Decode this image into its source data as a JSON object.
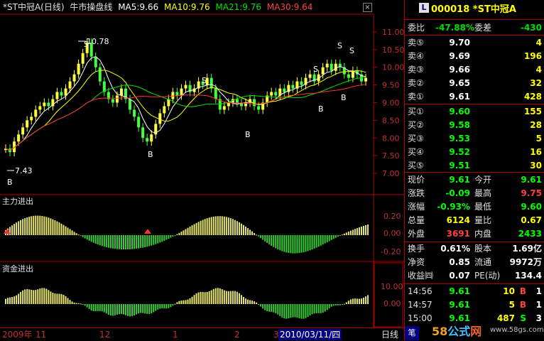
{
  "header": {
    "stock": "*ST中冠A(日线)",
    "indicator": "牛市操盘线",
    "ma5": "MA5:9.66",
    "ma10": "MA10:9.76",
    "ma21": "MA21:9.76",
    "ma30": "MA30:9.64"
  },
  "main_chart": {
    "y_ticks": [
      "11.00",
      "10.50",
      "10.00",
      "9.50",
      "9.00",
      "8.50",
      "8.00",
      "7.50",
      "7.00"
    ],
    "annotations": {
      "high_label": "10.78",
      "low_label": "7.43",
      "buy": "B",
      "sell": "S"
    }
  },
  "panel1": {
    "title": "主力进出",
    "y_ticks": [
      "0.20",
      "0.00",
      "-0.20"
    ]
  },
  "panel2": {
    "title": "资金进出",
    "y_ticks": [
      "10.00",
      "0.00"
    ]
  },
  "bottom_axis": {
    "labels": [
      "2009年",
      "11",
      "12",
      "1",
      "2",
      "3",
      "2010/03/11/四"
    ],
    "period": "日线",
    "tab": "笔"
  },
  "quote": {
    "badge": "L",
    "code_name": "000018 *ST中冠A",
    "weibi_label": "委比",
    "weibi_value": "-47.88%",
    "weicha_label": "委差",
    "weicha_value": "-430",
    "sells": [
      {
        "label": "卖⑤",
        "price": "9.70",
        "vol": "4"
      },
      {
        "label": "卖④",
        "price": "9.69",
        "vol": "196"
      },
      {
        "label": "卖③",
        "price": "9.66",
        "vol": "4"
      },
      {
        "label": "卖②",
        "price": "9.65",
        "vol": "32"
      },
      {
        "label": "卖①",
        "price": "9.61",
        "vol": "428"
      }
    ],
    "buys": [
      {
        "label": "买①",
        "price": "9.60",
        "vol": "155"
      },
      {
        "label": "买②",
        "price": "9.58",
        "vol": "28"
      },
      {
        "label": "买③",
        "price": "9.53",
        "vol": "5"
      },
      {
        "label": "买④",
        "price": "9.52",
        "vol": "16"
      },
      {
        "label": "买⑤",
        "price": "9.51",
        "vol": "30"
      }
    ],
    "stats": [
      {
        "l1": "现价",
        "v1": "9.61",
        "l2": "今开",
        "v2": "9.61"
      },
      {
        "l1": "涨跌",
        "v1": "-0.09",
        "l2": "最高",
        "v2": "9.75"
      },
      {
        "l1": "涨幅",
        "v1": "-0.93%",
        "l2": "最低",
        "v2": "9.60"
      },
      {
        "l1": "总量",
        "v1": "6124",
        "l2": "量比",
        "v2": "0.67"
      },
      {
        "l1": "外盘",
        "v1": "3691",
        "l2": "内盘",
        "v2": "2433"
      }
    ],
    "fund": [
      {
        "l1": "换手",
        "v1": "0.61%",
        "l2": "股本",
        "v2": "1.69亿"
      },
      {
        "l1": "净资",
        "v1": "0.85",
        "l2": "流通",
        "v2": "9972万"
      },
      {
        "l1": "收益㈣",
        "v1": "0.07",
        "l2": "PE(动)",
        "v2": "134.4"
      }
    ],
    "ticks": [
      {
        "time": "14:56",
        "price": "9.61",
        "vol": "10",
        "side": "B",
        "n": "1"
      },
      {
        "time": "14:57",
        "price": "9.61",
        "vol": "5",
        "side": "B",
        "n": "1"
      },
      {
        "time": "15:00",
        "price": "9.61",
        "vol": "487",
        "side": "S",
        "n": "3"
      }
    ]
  },
  "watermark": {
    "text": "58公式网",
    "url": "www.58gs.com"
  }
}
